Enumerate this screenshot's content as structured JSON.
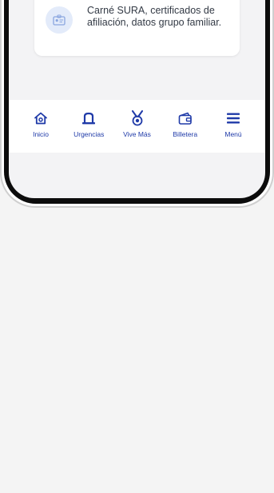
{
  "card": {
    "icon": "id-card-icon",
    "description": "Carné SURA, certificados de afiliación, datos grupo familiar."
  },
  "bottom_nav": {
    "items": [
      {
        "label": "Inicio",
        "icon": "home-icon"
      },
      {
        "label": "Urgencias",
        "icon": "siren-icon"
      },
      {
        "label": "Vive Más",
        "icon": "medal-icon"
      },
      {
        "label": "Billetera",
        "icon": "wallet-icon"
      },
      {
        "label": "Menú",
        "icon": "hamburger-menu-icon"
      }
    ]
  },
  "colors": {
    "brand_blue": "#1f3aa8",
    "icon_bg": "#e3ebfa",
    "screen_bg": "#f3f3f5"
  }
}
